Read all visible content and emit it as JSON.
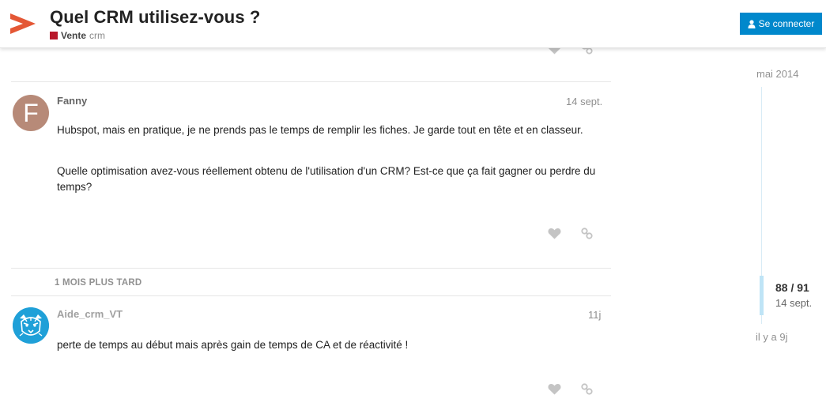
{
  "header": {
    "title": "Quel CRM utilisez-vous ?",
    "category": "Vente",
    "category_color": "#b8182a",
    "tag": "crm",
    "login_label": "Se connecter",
    "brand_color": "#e45735",
    "button_color": "#0088cc"
  },
  "posts": [
    {
      "username": "Fanny",
      "avatar_letter": "F",
      "avatar_color": "#b78a78",
      "date": "14 sept.",
      "paragraphs": [
        "Hubspot, mais en pratique, je ne prends pas le temps de remplir les fiches. Je garde tout en tête et en classeur.",
        "Quelle optimisation avez-vous réellement obtenu de l'utilisation d'un CRM? Est-ce que ça fait gagner ou perdre du temps?"
      ]
    },
    {
      "username": "Aide_crm_VT",
      "avatar_icon": "tiger-avatar-icon",
      "avatar_color": "#1fa0d8",
      "date": "11j",
      "paragraphs": [
        "perte de temps au début mais après gain de temps de CA et de réactivité !"
      ]
    }
  ],
  "gap_label": "1 MOIS PLUS TARD",
  "timeline": {
    "start_label": "mai 2014",
    "counter": "88 / 91",
    "current_date": "14 sept.",
    "end_label": "il y a 9j"
  },
  "icons": {
    "like": "heart-icon",
    "share": "link-icon",
    "login": "user-icon"
  }
}
